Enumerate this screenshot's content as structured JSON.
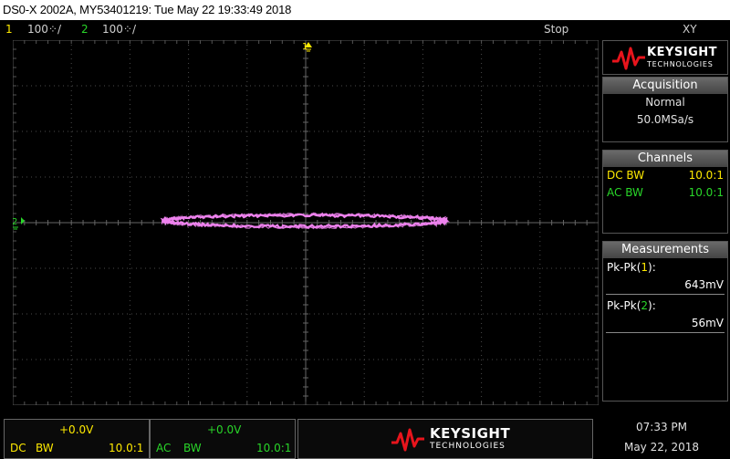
{
  "title_bar": {
    "text": "DS0-X 2002A, MY53401219: Tue May 22 19:33:49 2018"
  },
  "status": {
    "ch1_num": "1",
    "ch1_scale": "100⁘/",
    "ch2_num": "2",
    "ch2_scale": "100⁘/",
    "run_state": "Stop",
    "mode": "XY"
  },
  "display": {
    "ch1_marker": "1",
    "ch2_marker": "2",
    "trace_color": "#ee82ee"
  },
  "brand": {
    "name": "KEYSIGHT",
    "sub": "TECHNOLOGIES",
    "logo_color": "#e8141c"
  },
  "acquisition": {
    "header": "Acquisition",
    "mode": "Normal",
    "rate": "50.0MSa/s"
  },
  "channels": {
    "header": "Channels",
    "ch1": {
      "coupling": "DC BW",
      "probe": "10.0:1",
      "color": "#ffea00"
    },
    "ch2": {
      "coupling": "AC BW",
      "probe": "10.0:1",
      "color": "#29d629"
    }
  },
  "measurements": {
    "header": "Measurements",
    "m1_label_pre": "Pk-Pk(",
    "m1_src": "1",
    "m1_label_post": "):",
    "m1_value": "643mV",
    "m2_label_pre": "Pk-Pk(",
    "m2_src": "2",
    "m2_label_post": "):",
    "m2_value": "56mV"
  },
  "bottom": {
    "ch1_offset": "+0.0V",
    "ch1_coupling": "DC",
    "ch1_bw": "BW",
    "ch1_probe": "10.0:1",
    "ch2_offset": "+0.0V",
    "ch2_coupling": "AC",
    "ch2_bw": "BW",
    "ch2_probe": "10.0:1",
    "time": "07:33 PM",
    "date": "May 22, 2018"
  }
}
